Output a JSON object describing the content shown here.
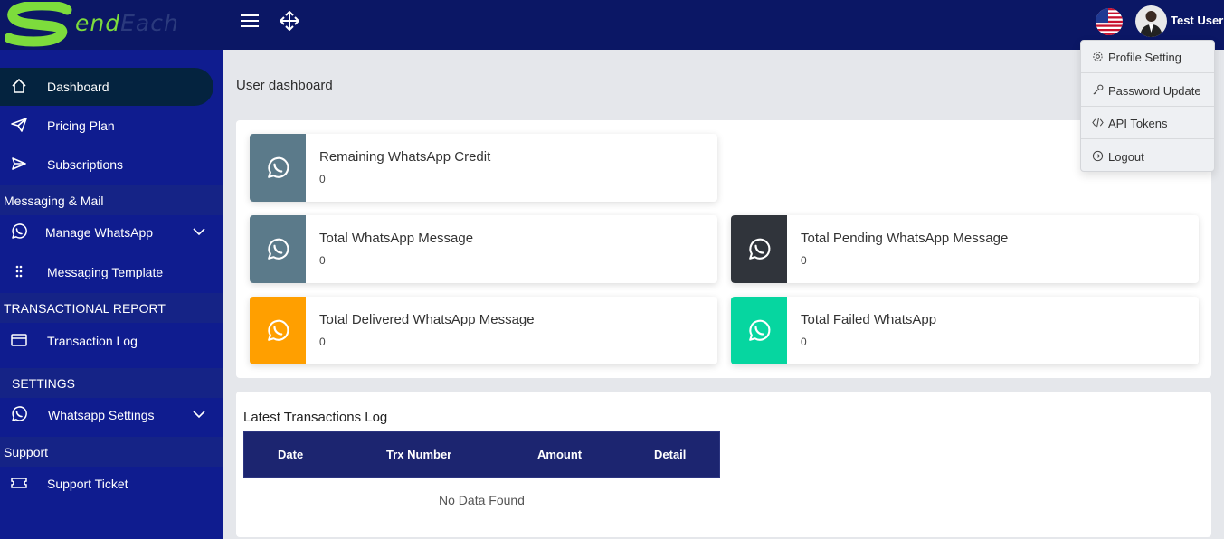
{
  "brand": {
    "logo_letter": "S",
    "logo_text_a": "end",
    "logo_text_b": "Each"
  },
  "header": {
    "username": "Test User"
  },
  "sidebar": {
    "items": [
      {
        "label": "Dashboard",
        "icon": "home-icon",
        "active": true
      },
      {
        "label": "Pricing Plan",
        "icon": "paper-plane-icon"
      },
      {
        "label": "Subscriptions",
        "icon": "send-icon"
      },
      {
        "section": "Messaging & Mail"
      },
      {
        "label": "Manage WhatsApp",
        "icon": "whatsapp-icon",
        "expandable": true
      },
      {
        "label": "Messaging Template",
        "icon": "dots-grid-icon"
      },
      {
        "section": "TRANSACTIONAL REPORT"
      },
      {
        "label": "Transaction Log",
        "icon": "credit-card-icon"
      },
      {
        "section": "SETTINGS"
      },
      {
        "label": "Whatsapp Settings",
        "icon": "whatsapp-icon",
        "expandable": true
      },
      {
        "section": "Support"
      },
      {
        "label": "Support Ticket",
        "icon": "ticket-icon"
      }
    ]
  },
  "main": {
    "page_title": "User dashboard",
    "cards": [
      {
        "title": "Remaining WhatsApp Credit",
        "value": "0",
        "color": "#5b7a8a"
      },
      {
        "title": "Total WhatsApp Message",
        "value": "0",
        "color": "#5b7a8a"
      },
      {
        "title": "Total Pending WhatsApp Message",
        "value": "0",
        "color": "#30343b"
      },
      {
        "title": "Total Delivered WhatsApp Message",
        "value": "0",
        "color": "#ff9f00"
      },
      {
        "title": "Total Failed WhatsApp",
        "value": "0",
        "color": "#06d6a0"
      }
    ],
    "transactions": {
      "title": "Latest Transactions Log",
      "columns": [
        "Date",
        "Trx Number",
        "Amount",
        "Detail"
      ],
      "empty_text": "No Data Found"
    }
  },
  "dropdown": {
    "items": [
      {
        "label": "Profile Setting",
        "icon": "gear-icon"
      },
      {
        "label": "Password Update",
        "icon": "key-icon"
      },
      {
        "label": "API Tokens",
        "icon": "code-icon"
      },
      {
        "label": "Logout",
        "icon": "logout-icon"
      }
    ]
  },
  "colors": {
    "header_bg": "#0b1765",
    "sidebar_bg": "#0f1c8f",
    "active_item_bg": "#04233f",
    "table_head_bg": "#1c2570"
  }
}
